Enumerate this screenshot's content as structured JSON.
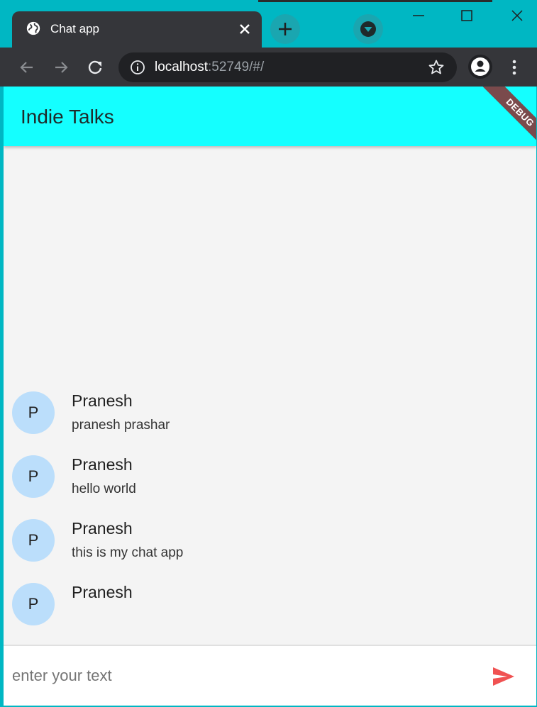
{
  "browser": {
    "tab_title": "Chat app",
    "url_host": "localhost",
    "url_rest": ":52749/#/"
  },
  "app": {
    "title": "Indie Talks",
    "debug_banner": "DEBUG",
    "appbar_color": "#14ffff",
    "messages": [
      {
        "avatar": "P",
        "sender": "Pranesh",
        "text": "pranesh prashar"
      },
      {
        "avatar": "P",
        "sender": "Pranesh",
        "text": "hello world"
      },
      {
        "avatar": "P",
        "sender": "Pranesh",
        "text": "this is my chat app"
      },
      {
        "avatar": "P",
        "sender": "Pranesh",
        "text": ""
      }
    ],
    "composer": {
      "placeholder": "enter your text",
      "value": ""
    },
    "send_color": "#f05252"
  },
  "icons": {
    "tab": "globe-icon",
    "close": "close-icon",
    "new_tab": "plus-icon",
    "tab_search": "chevron-down-icon",
    "back": "arrow-left-icon",
    "forward": "arrow-right-icon",
    "reload": "reload-icon",
    "info": "info-icon",
    "bookmark": "star-icon",
    "profile": "person-icon",
    "menu": "kebab-menu-icon",
    "send": "send-icon"
  }
}
